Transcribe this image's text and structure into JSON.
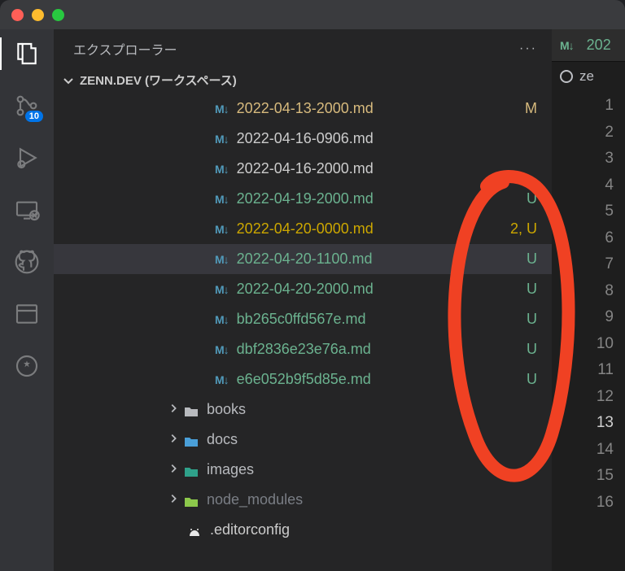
{
  "sidebar": {
    "title": "エクスプローラー",
    "workspace_label": "ZENN.DEV (ワークスペース)"
  },
  "activity": {
    "scm_badge": "10"
  },
  "files": [
    {
      "icon": "md",
      "name": "2022-04-13-2000.md",
      "status": "M",
      "class": "modified",
      "status_class": "modified"
    },
    {
      "icon": "md",
      "name": "2022-04-16-0906.md",
      "status": "",
      "class": "default",
      "status_class": "default"
    },
    {
      "icon": "md",
      "name": "2022-04-16-2000.md",
      "status": "",
      "class": "default",
      "status_class": "default"
    },
    {
      "icon": "md",
      "name": "2022-04-19-2000.md",
      "status": "U",
      "class": "untracked",
      "status_class": "untracked"
    },
    {
      "icon": "md",
      "name": "2022-04-20-0000.md",
      "status": "2, U",
      "class": "warning",
      "status_class": "warning"
    },
    {
      "icon": "md",
      "name": "2022-04-20-1100.md",
      "status": "U",
      "class": "untracked",
      "status_class": "untracked",
      "selected": true
    },
    {
      "icon": "md",
      "name": "2022-04-20-2000.md",
      "status": "U",
      "class": "untracked",
      "status_class": "untracked"
    },
    {
      "icon": "md",
      "name": "bb265c0ffd567e.md",
      "status": "U",
      "class": "untracked",
      "status_class": "untracked"
    },
    {
      "icon": "md",
      "name": "dbf2836e23e76a.md",
      "status": "U",
      "class": "untracked",
      "status_class": "untracked"
    },
    {
      "icon": "md",
      "name": "e6e052b9f5d85e.md",
      "status": "U",
      "class": "untracked",
      "status_class": "untracked"
    }
  ],
  "folders": [
    {
      "name": "books",
      "icon_fill": "#b8babe",
      "dim": false
    },
    {
      "name": "docs",
      "icon_fill": "#4a9fd8",
      "dim": false
    },
    {
      "name": "images",
      "icon_fill": "#2fa18a",
      "dim": false
    },
    {
      "name": "node_modules",
      "icon_fill": "#8cc84b",
      "dim": true
    }
  ],
  "editorconfig": {
    "name": ".editorconfig"
  },
  "editor": {
    "tab_label": "202",
    "breadcrumb_label": "ze",
    "line_numbers": [
      1,
      2,
      3,
      4,
      5,
      6,
      7,
      8,
      9,
      10,
      11,
      12,
      13,
      14,
      15,
      16
    ],
    "current_line": 13
  },
  "annotation_color": "#f04123"
}
